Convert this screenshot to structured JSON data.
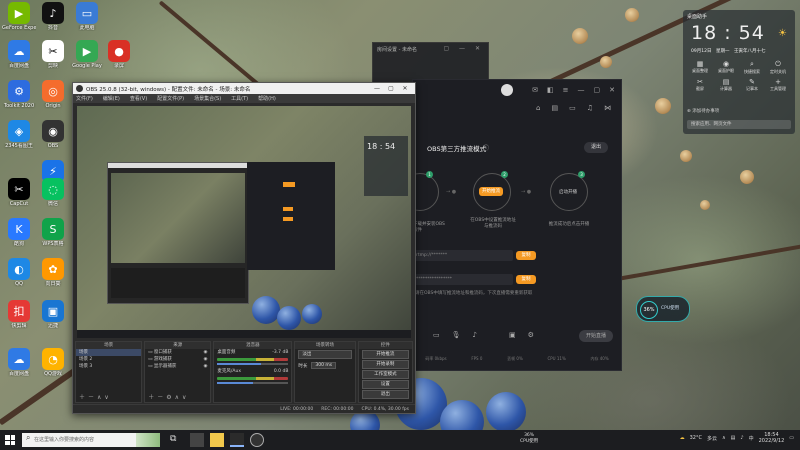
{
  "desktop": {
    "icons": [
      {
        "label": "GeForce Experience",
        "glyph": "▶",
        "color": "#76b900"
      },
      {
        "label": "抖音",
        "glyph": "♪",
        "color": "#111111"
      },
      {
        "label": "此电脑",
        "glyph": "▭",
        "color": "#3a7bd5"
      },
      {
        "label": "百度网盘",
        "glyph": "☁",
        "color": "#2f7ae5"
      },
      {
        "label": "剪映",
        "glyph": "✂",
        "color": "#ffffff"
      },
      {
        "label": "Google Play",
        "glyph": "▶",
        "color": "#34a853"
      },
      {
        "label": "录屏",
        "glyph": "●",
        "color": "#d93025"
      },
      {
        "label": "Toolkit 2020",
        "glyph": "⚙",
        "color": "#2d6cdf"
      },
      {
        "label": "Origin",
        "glyph": "◎",
        "color": "#f56c2d"
      },
      {
        "label": "2345看图王",
        "glyph": "◈",
        "color": "#1e88e5"
      },
      {
        "label": "OBS",
        "glyph": "◉",
        "color": "#333333"
      },
      {
        "label": "迅雷",
        "glyph": "⚡",
        "color": "#1a73e8"
      },
      {
        "label": "CapCut",
        "glyph": "✂",
        "color": "#000000"
      },
      {
        "label": "微信",
        "glyph": "◌",
        "color": "#07c160"
      },
      {
        "label": "酷狗",
        "glyph": "K",
        "color": "#2979ff"
      },
      {
        "label": "WPS表格",
        "glyph": "S",
        "color": "#10a34a"
      },
      {
        "label": "QQ",
        "glyph": "◐",
        "color": "#1e88e5"
      },
      {
        "label": "向日葵",
        "glyph": "✿",
        "color": "#ff9800"
      },
      {
        "label": "快剪辑",
        "glyph": "扣",
        "color": "#e53935"
      },
      {
        "label": "迅捷",
        "glyph": "▣",
        "color": "#1976d2"
      },
      {
        "label": "百度网盘",
        "glyph": "☁",
        "color": "#2f7ae5"
      },
      {
        "label": "QQ游戏",
        "glyph": "◔",
        "color": "#ffb300"
      }
    ]
  },
  "obs": {
    "title": "OBS 25.0.8 (32-bit, windows) - 配置文件: 未命名 - 场景: 未命名",
    "menu": [
      "文件(F)",
      "编辑(E)",
      "查看(V)",
      "配置文件(P)",
      "场景集合(S)",
      "工具(T)",
      "帮助(H)"
    ],
    "docks": {
      "scenes_header": "场景",
      "scenes": [
        "场景",
        "场景 2",
        "场景 3"
      ],
      "sources_header": "来源",
      "sources": [
        "窗口捕获",
        "游戏捕获",
        "显示器捕获"
      ],
      "mixer_header": "混音器",
      "mixer": [
        {
          "label": "桌面音频",
          "db": "-3.7 dB",
          "level": 0.62
        },
        {
          "label": "麦克风/Aux",
          "db": "0.0 dB",
          "level": 0.5
        }
      ],
      "transitions_header": "场景转场",
      "transition_value": "淡出",
      "duration_label": "时长",
      "duration_value": "300 ms",
      "controls_header": "控件",
      "controls": [
        "开始推流",
        "开始录制",
        "工作室模式",
        "设置",
        "退出"
      ]
    },
    "status": {
      "live": "LIVE: 00:00:00",
      "rec": "REC: 00:00:00",
      "cpu": "CPU: 0.4%, 30.00 fps"
    }
  },
  "live_app": {
    "mode_title": "OBS第三方推流模式",
    "exit_label": "退出",
    "steps": [
      {
        "num": "1",
        "label": "下载并安装OBS软件",
        "active": false
      },
      {
        "num": "2",
        "label": "在OBS中设置推流地址与推流码",
        "active": true,
        "button": "开始推流"
      },
      {
        "num": "3",
        "label": "开启直播",
        "active": false,
        "button": "启动开播"
      }
    ],
    "step3_desc": "推流成功后点击开播",
    "address_placeholder": "rtmp://*******",
    "code_placeholder": "****************",
    "copy_label": "复制",
    "hint": "请在OBS中填写推流地址和推流码，下次直播需要重新获取",
    "start_label": "开始直播",
    "stats": [
      "码率 0kbps",
      "FPS 0",
      "丢帧 0%",
      "CPU 11%",
      "内存 40%"
    ]
  },
  "back_window": {
    "title": "房间设置 - 未命名"
  },
  "clock_widget": {
    "header": "桌面助手",
    "time": "18 : 54",
    "date": "09月12日　星期一　壬寅年八月十七",
    "shortcuts": [
      {
        "label": "桌面整理",
        "glyph": "▦"
      },
      {
        "label": "桌面护眼",
        "glyph": "◉"
      },
      {
        "label": "快捷搜索",
        "glyph": "⌕"
      },
      {
        "label": "定时关机",
        "glyph": "⏻"
      },
      {
        "label": "截屏",
        "glyph": "✂"
      },
      {
        "label": "计算器",
        "glyph": "▤"
      },
      {
        "label": "记事本",
        "glyph": "✎"
      },
      {
        "label": "工具管理",
        "glyph": "+"
      }
    ],
    "add_event": "添加待办事项",
    "search_placeholder": "搜索应用、网页文件"
  },
  "cpu_widget": {
    "value": "36%",
    "label": "CPU使用"
  },
  "taskbar": {
    "search_placeholder": "在这里输入你要搜索的内容",
    "cpu_value": "36%",
    "cpu_label": "CPU使用",
    "temperature": "32°C",
    "weather": "多云",
    "ime": "中",
    "time": "18:54",
    "date": "2022/9/12"
  }
}
